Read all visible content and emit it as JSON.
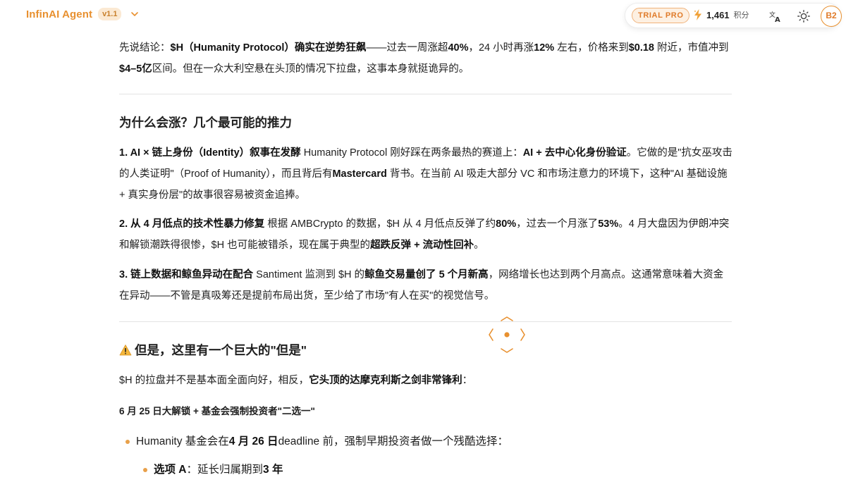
{
  "header": {
    "brand": "InfinAI Agent",
    "version": "v1.1",
    "trial_badge": "TRIAL PRO",
    "points_value": "1,461",
    "points_label": "积分",
    "avatar": "B2"
  },
  "icons": {
    "dropdown": "chevron-down-icon",
    "points": "lightning-icon",
    "translate": "translate-icon",
    "theme": "sun-icon",
    "warning": "warning-icon",
    "focus": "focus-target-icon"
  },
  "colors": {
    "accent": "#e8902f",
    "trial_bg": "#fdf0e2",
    "text": "#1f1f1f"
  },
  "article": {
    "p1": {
      "a": "先说结论：",
      "b": "$H（Humanity Protocol）确实在逆势狂飙",
      "c": "——过去一周涨超",
      "d": "40%",
      "e": "，24 小时再涨",
      "f": "12%",
      "g": " 左右，价格来到",
      "h": "$0.18",
      "i": " 附近，市值冲到",
      "j": "$4–5亿",
      "k": "区间。但在一众大利空悬在头顶的情况下拉盘，这事本身就挺诡异的。"
    },
    "heading_why": "为什么会涨？几个最可能的推力",
    "p2": {
      "a": "1. AI × 链上身份（Identity）叙事在发酵",
      "b": " Humanity Protocol 刚好踩在两条最热的赛道上：",
      "c": "AI + 去中心化身份验证",
      "d": "。它做的是\"抗女巫攻击的人类证明\"（Proof of Humanity），而且背后有",
      "e": "Mastercard",
      "f": " 背书。在当前 AI 吸走大部分 VC 和市场注意力的环境下，这种\"AI 基础设施 + 真实身份层\"的故事很容易被资金追捧。"
    },
    "p3": {
      "a": "2. 从 4 月低点的技术性暴力修复",
      "b": " 根据 AMBCrypto 的数据，$H 从 4 月低点反弹了约",
      "c": "80%",
      "d": "，过去一个月涨了",
      "e": "53%",
      "f": "。4 月大盘因为伊朗冲突和解锁潮跌得很惨，$H 也可能被错杀，现在属于典型的",
      "g": "超跌反弹 + 流动性回补",
      "h": "。"
    },
    "p4": {
      "a": "3. 链上数据和鲸鱼异动在配合",
      "b": " Santiment 监测到 $H 的",
      "c": "鲸鱼交易量创了 5 个月新高",
      "d": "，网络增长也达到两个月高点。这通常意味着大资金在异动——不管是真吸筹还是提前布局出货，至少给了市场\"有人在买\"的视觉信号。"
    },
    "heading_but": "但是，这里有一个巨大的\"但是\"",
    "p5": {
      "a": "$H 的拉盘并不是基本面全面向好，相反，",
      "b": "它头顶的达摩克利斯之剑非常锋利",
      "c": "："
    },
    "subheading": "6 月 25 日大解锁 + 基金会强制投资者\"二选一\"",
    "bullet1": {
      "a": "Humanity 基金会在",
      "b": "4 月 26 日",
      "c": " deadline 前，强制早期投资者做一个残酷选择："
    },
    "bullet2": {
      "a": "选项 A",
      "b": "：延长归属期到",
      "c": "3 年"
    }
  }
}
